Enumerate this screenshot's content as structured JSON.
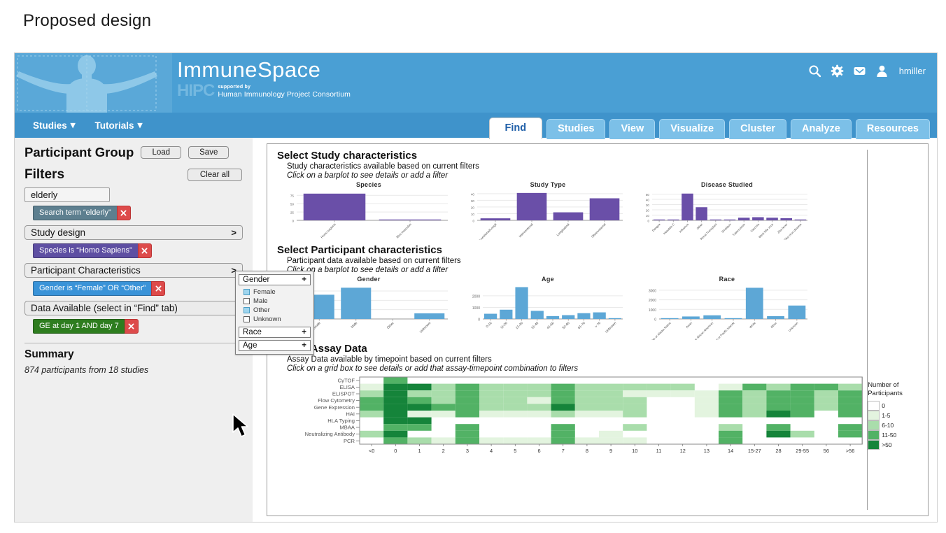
{
  "slide": {
    "title": "Proposed design"
  },
  "banner": {
    "product": "ImmuneSpace",
    "hipc_mark": "HIPC",
    "hipc_supported_by": "supported by",
    "hipc_full": "Human Immunology Project Consortium",
    "user": "hmiller",
    "icons": [
      "search-icon",
      "gear-icon",
      "inbox-icon",
      "user-icon"
    ]
  },
  "nav": {
    "menus": [
      {
        "label": "Studies",
        "caret": "▾"
      },
      {
        "label": "Tutorials",
        "caret": "▾"
      }
    ],
    "tabs": [
      {
        "label": "Find",
        "active": true
      },
      {
        "label": "Studies",
        "active": false
      },
      {
        "label": "View",
        "active": false
      },
      {
        "label": "Visualize",
        "active": false
      },
      {
        "label": "Cluster",
        "active": false
      },
      {
        "label": "Analyze",
        "active": false
      },
      {
        "label": "Resources",
        "active": false
      }
    ]
  },
  "sidebar": {
    "participant_group_title": "Participant Group",
    "load_label": "Load",
    "save_label": "Save",
    "filters_title": "Filters",
    "clear_all_label": "Clear all",
    "search_value": "elderly",
    "groups": [
      {
        "name": "search",
        "header": null,
        "chip": {
          "label": "Search term “elderly”",
          "color": "#5d7f8f"
        }
      },
      {
        "name": "study-design",
        "header": "Study design",
        "arrow": ">",
        "chip": {
          "label": "Species is “Homo Sapiens”",
          "color": "#5e4fa2"
        }
      },
      {
        "name": "participant-characteristics",
        "header": "Participant Characteristics",
        "arrow": ">",
        "chip": {
          "label": "Gender is “Female” OR “Other”",
          "color": "#3a93d8"
        }
      },
      {
        "name": "data-available",
        "header": "Data Available (select in “Find” tab)",
        "arrow": "",
        "chip": {
          "label": "GE at day 1 AND day 7",
          "color": "#2e7d1f"
        }
      }
    ],
    "summary_title": "Summary",
    "summary_text": "874 participants from 18 studies"
  },
  "popup": {
    "sections": [
      {
        "label": "Gender",
        "plus": "+",
        "expanded": true,
        "options": [
          {
            "label": "Female",
            "checked": true
          },
          {
            "label": "Male",
            "checked": false
          },
          {
            "label": "Other",
            "checked": true
          },
          {
            "label": "Unknown",
            "checked": false
          }
        ]
      },
      {
        "label": "Race",
        "plus": "+",
        "expanded": false,
        "options": []
      },
      {
        "label": "Age",
        "plus": "+",
        "expanded": false,
        "options": []
      }
    ]
  },
  "sections": {
    "study": {
      "title": "Select Study characteristics",
      "sub1": "Study characteristics available based on current filters",
      "sub2": "Click on a barplot to see details or add a filter"
    },
    "participant": {
      "title": "Select Participant characteristics",
      "sub1": "Participant data available based on current filters",
      "sub2": "Click on a barplot to see details or add a filter"
    },
    "assay": {
      "title": "Select Assay Data",
      "sub1": "Assay Data available by timepoint based on current filters",
      "sub2": "Click on a grid box to see details or add that assay-timepoint combination to filters"
    }
  },
  "chart_data": [
    {
      "type": "bar",
      "title": "Species",
      "xlabel": "",
      "ylabel": "",
      "categories": [
        "Homo sapiens",
        "Mus musculus"
      ],
      "values": [
        80,
        1
      ],
      "ylim": [
        0,
        88
      ],
      "yticks": [
        0,
        25,
        50,
        75
      ],
      "color": "#6a4fa8",
      "grid": true
    },
    {
      "type": "bar",
      "title": "Study Type",
      "xlabel": "",
      "ylabel": "",
      "categories": [
        "Cross-sectional/Longitudinal",
        "Interventional",
        "Longitudinal",
        "Observational"
      ],
      "values": [
        3,
        41,
        12,
        33
      ],
      "ylim": [
        0,
        44
      ],
      "yticks": [
        0,
        10,
        20,
        30,
        40
      ],
      "color": "#6a4fa8",
      "grid": true
    },
    {
      "type": "bar",
      "title": "Disease Studied",
      "xlabel": "",
      "ylabel": "",
      "categories": [
        "Dengue",
        "Hepatitis C",
        "Influenza",
        "Other",
        "Renal Transplant",
        "Smallpox",
        "Tuberculosis",
        "Vaccinia",
        "West Nile virus",
        "Zika fever",
        "Zika virus disease"
      ],
      "values": [
        1,
        1,
        51,
        25,
        1,
        1,
        5,
        6,
        5,
        4,
        1
      ],
      "ylim": [
        0,
        56
      ],
      "yticks": [
        0,
        10,
        20,
        30,
        40,
        50
      ],
      "color": "#6a4fa8",
      "grid": true
    },
    {
      "type": "bar",
      "title": "Gender",
      "xlabel": "",
      "ylabel": "",
      "categories": [
        "Female",
        "Male",
        "Other",
        "Unknown"
      ],
      "values": [
        2600,
        3350,
        0,
        600
      ],
      "ylim": [
        0,
        3600
      ],
      "yticks": [
        0,
        1000,
        2000,
        3000
      ],
      "color": "#5da7d6",
      "grid": true
    },
    {
      "type": "bar",
      "title": "Age",
      "xlabel": "",
      "ylabel": "",
      "categories": [
        "0-10",
        "11-20",
        "21-30",
        "31-40",
        "41-50",
        "51-60",
        "61-70",
        "> 70",
        "Unknown"
      ],
      "values": [
        450,
        800,
        2750,
        700,
        250,
        330,
        500,
        570,
        40
      ],
      "ylim": [
        0,
        2900
      ],
      "yticks": [
        0,
        1000,
        2000
      ],
      "color": "#5da7d6",
      "grid": true
    },
    {
      "type": "bar",
      "title": "Race",
      "xlabel": "",
      "ylabel": "",
      "categories": [
        "American Indian or Alaska Native",
        "Asian",
        "Black or African American",
        "Native Hawaiian or Pacific Islander",
        "White",
        "Other",
        "Unknown"
      ],
      "values": [
        80,
        260,
        380,
        40,
        3250,
        290,
        1400
      ],
      "ylim": [
        0,
        3500
      ],
      "yticks": [
        0,
        1000,
        2000,
        3000
      ],
      "color": "#5da7d6",
      "grid": true
    },
    {
      "type": "heatmap",
      "title": "",
      "xlabel": "",
      "ylabel": "",
      "x_categories": [
        "<0",
        "0",
        "1",
        "2",
        "3",
        "4",
        "5",
        "6",
        "7",
        "8",
        "9",
        "10",
        "11",
        "12",
        "13",
        "14",
        "15-27",
        "28",
        "29-55",
        "56",
        ">56"
      ],
      "y_categories": [
        "CyTOF",
        "ELISA",
        "ELISPOT",
        "Flow Cytometry",
        "Gene Expression",
        "HAI",
        "HLA Typing",
        "MBAA",
        "Neutralizing Antibody",
        "PCR"
      ],
      "legend_title": "Number of Participants",
      "legend_bins": [
        {
          "label": "0",
          "color": "#ffffff"
        },
        {
          "label": "1-5",
          "color": "#e3f4df"
        },
        {
          "label": "6-10",
          "color": "#a9ddab"
        },
        {
          "label": "11-50",
          "color": "#52b265"
        },
        {
          "label": ">50",
          "color": "#15843a"
        }
      ],
      "values": [
        [
          0,
          3,
          0,
          0,
          0,
          0,
          0,
          0,
          0,
          0,
          0,
          0,
          0,
          0,
          0,
          0,
          0,
          0,
          0,
          0,
          0
        ],
        [
          1,
          4,
          4,
          2,
          3,
          2,
          2,
          2,
          3,
          2,
          2,
          2,
          2,
          2,
          0,
          1,
          3,
          2,
          3,
          3,
          2
        ],
        [
          2,
          4,
          2,
          2,
          3,
          2,
          2,
          2,
          3,
          2,
          2,
          1,
          1,
          1,
          1,
          3,
          2,
          3,
          3,
          2,
          3
        ],
        [
          3,
          4,
          3,
          2,
          3,
          2,
          2,
          1,
          3,
          2,
          2,
          2,
          0,
          0,
          1,
          3,
          2,
          3,
          3,
          2,
          3
        ],
        [
          3,
          4,
          4,
          3,
          3,
          2,
          2,
          2,
          4,
          2,
          2,
          2,
          0,
          0,
          1,
          3,
          2,
          3,
          3,
          2,
          3
        ],
        [
          2,
          4,
          1,
          1,
          3,
          1,
          1,
          1,
          2,
          1,
          1,
          2,
          0,
          0,
          1,
          3,
          2,
          4,
          3,
          0,
          3
        ],
        [
          0,
          4,
          4,
          0,
          0,
          0,
          0,
          0,
          0,
          0,
          0,
          0,
          0,
          0,
          0,
          0,
          0,
          0,
          0,
          0,
          0
        ],
        [
          0,
          3,
          3,
          0,
          3,
          0,
          0,
          0,
          3,
          0,
          0,
          2,
          0,
          0,
          0,
          2,
          0,
          3,
          0,
          0,
          3
        ],
        [
          2,
          4,
          0,
          0,
          3,
          0,
          0,
          0,
          3,
          0,
          1,
          0,
          0,
          0,
          0,
          3,
          0,
          4,
          2,
          0,
          3
        ],
        [
          0,
          3,
          2,
          1,
          3,
          1,
          1,
          1,
          3,
          1,
          1,
          1,
          0,
          0,
          0,
          3,
          0,
          0,
          0,
          0,
          0
        ]
      ]
    }
  ]
}
